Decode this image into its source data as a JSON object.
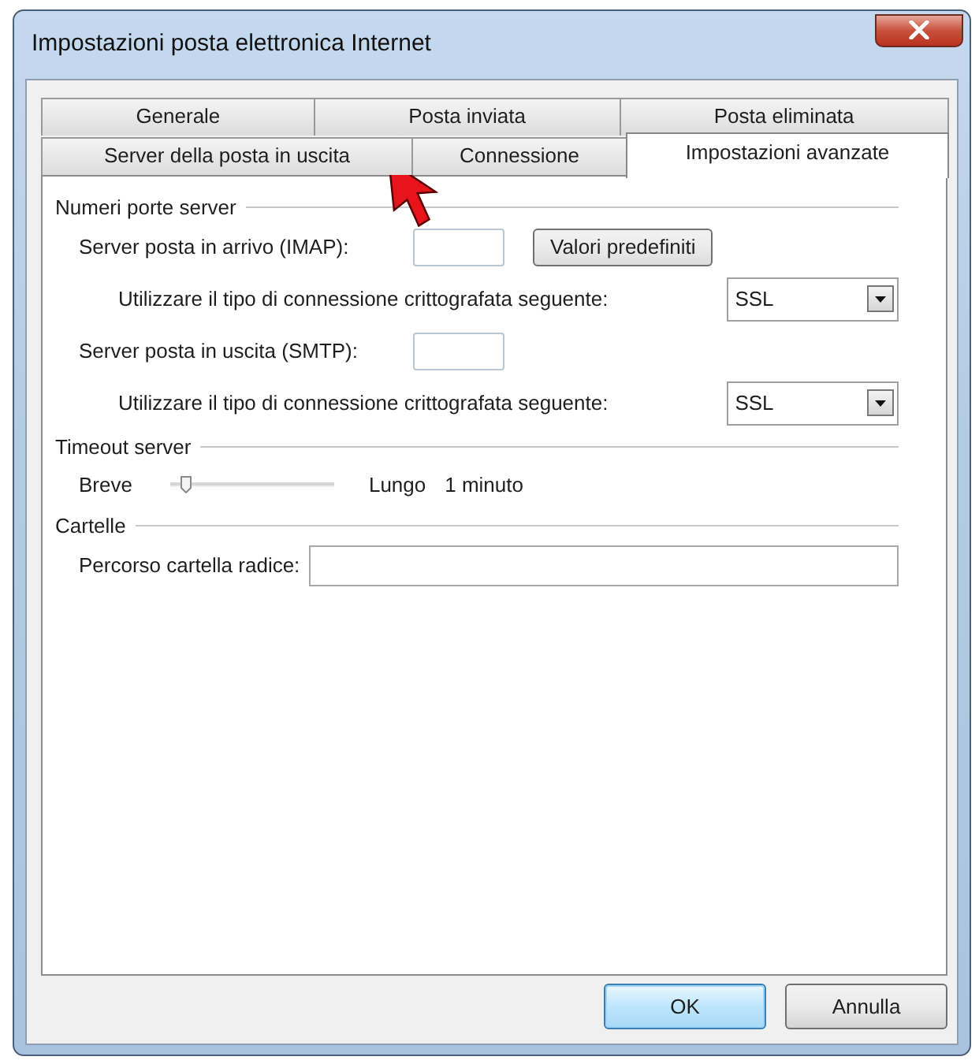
{
  "window": {
    "title": "Impostazioni posta elettronica Internet"
  },
  "tab_rows": [
    [
      {
        "label": "Generale",
        "selected": false
      },
      {
        "label": "Posta inviata",
        "selected": false
      },
      {
        "label": "Posta eliminata",
        "selected": false
      }
    ],
    [
      {
        "label": "Server della posta in uscita",
        "selected": false
      },
      {
        "label": "Connessione",
        "selected": false
      },
      {
        "label": "Impostazioni avanzate",
        "selected": true
      }
    ]
  ],
  "ports": {
    "title": "Numeri porte server",
    "rows": [
      {
        "kind": "port",
        "label": "Server posta in arrivo (IMAP):",
        "button": "Valori predefiniti"
      },
      {
        "kind": "encryption",
        "label": "Utilizzare il tipo di connessione crittografata seguente:",
        "value": "SSL"
      },
      {
        "kind": "port",
        "label": "Server posta in uscita (SMTP):"
      },
      {
        "kind": "encryption",
        "label": "Utilizzare il tipo di connessione crittografata seguente:",
        "value": "SSL"
      }
    ]
  },
  "timeout": {
    "title": "Timeout server",
    "min_label": "Breve",
    "max_label": "Lungo",
    "level": 0.1,
    "reading": "1 minuto"
  },
  "folders": {
    "title": "Cartelle",
    "root_path_label": "Percorso cartella radice:"
  },
  "buttons": [
    {
      "label": "OK",
      "default": true
    },
    {
      "label": "Annulla",
      "default": false
    }
  ]
}
